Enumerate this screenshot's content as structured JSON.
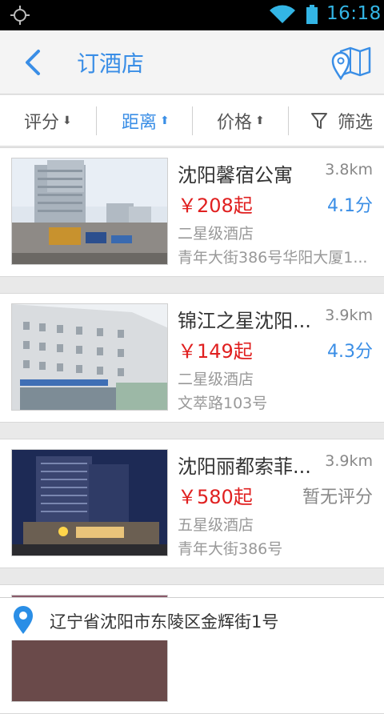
{
  "status_bar": {
    "time": "16:18",
    "icons": [
      "gps-icon",
      "wifi-icon",
      "battery-icon"
    ],
    "time_color": "#33b5e5"
  },
  "header": {
    "title": "订酒店",
    "back_icon": "chevron-left-icon",
    "map_icon": "map-icon",
    "accent": "#3a8ee6"
  },
  "sort_bar": {
    "items": [
      {
        "label": "评分",
        "arrow": "⬇",
        "active": false
      },
      {
        "label": "距离",
        "arrow": "⬆",
        "active": true
      },
      {
        "label": "价格",
        "arrow": "⬆",
        "active": false
      },
      {
        "label": "筛选",
        "icon": "filter-icon",
        "active": false
      }
    ]
  },
  "hotels": [
    {
      "name": "沈阳馨宿公寓",
      "distance": "3.8km",
      "price": "￥208起",
      "score": "4.1分",
      "star": "二星级酒店",
      "address": "青年大街386号华阳大厦1..."
    },
    {
      "name": "锦江之星沈阳...",
      "distance": "3.9km",
      "price": "￥149起",
      "score": "4.3分",
      "star": "二星级酒店",
      "address": "文萃路103号"
    },
    {
      "name": "沈阳丽都索菲...",
      "distance": "3.9km",
      "price": "￥580起",
      "score": "暂无评分",
      "star": "五星级酒店",
      "address": "青年大街386号"
    }
  ],
  "location_bar": {
    "icon": "location-pin-icon",
    "text": "辽宁省沈阳市东陵区金辉街1号"
  },
  "colors": {
    "price": "#e02020",
    "accent": "#3a8ee6",
    "muted": "#999999"
  }
}
